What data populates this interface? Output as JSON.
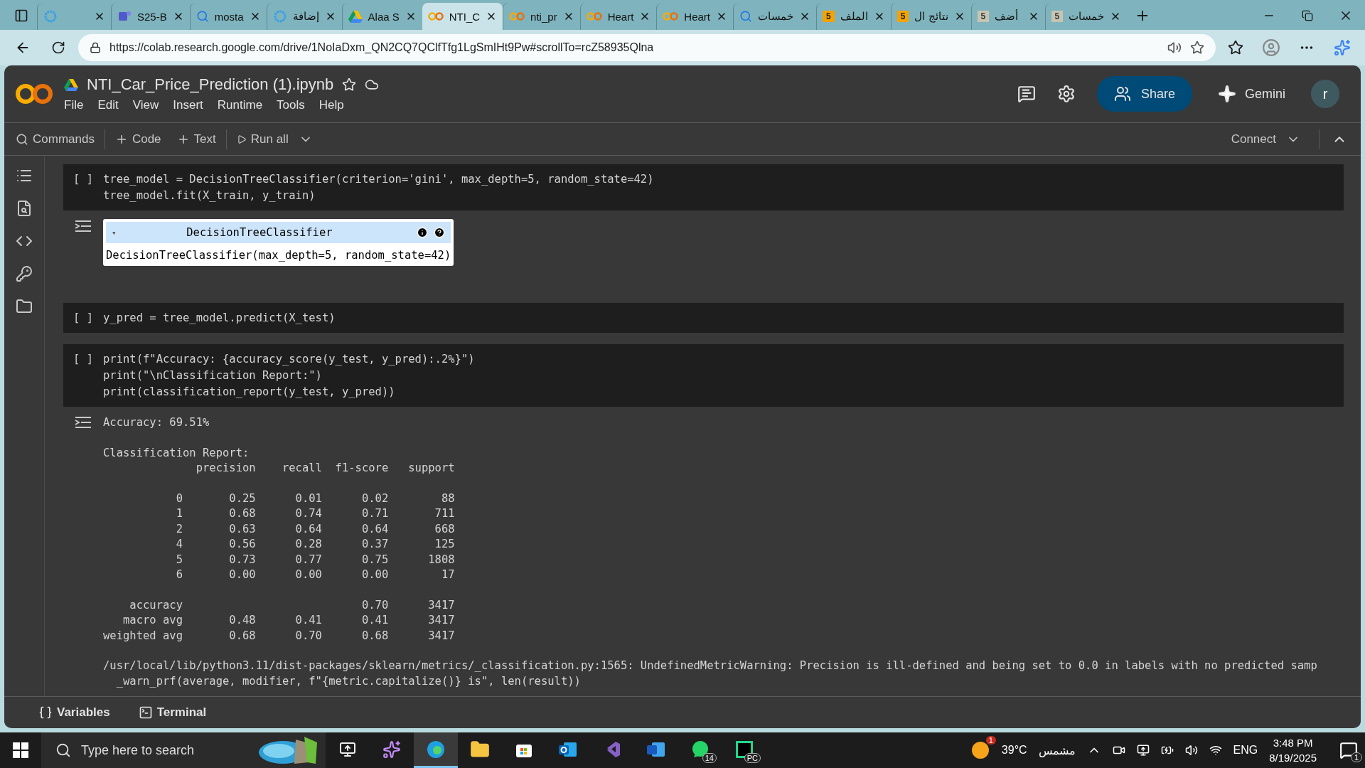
{
  "browser": {
    "tabs": [
      {
        "selected": false,
        "dimmed": false
      },
      {
        "label": "S25-B",
        "selected": false,
        "dimmed": false
      },
      {
        "label": "mosta",
        "selected": false,
        "dimmed": false
      },
      {
        "label": "إضافة",
        "selected": false,
        "dimmed": false
      },
      {
        "label": "Alaa S",
        "selected": false,
        "dimmed": false
      },
      {
        "label": "NTI_C",
        "selected": true,
        "dimmed": false
      },
      {
        "label": "nti_pr",
        "selected": false,
        "dimmed": false
      },
      {
        "label": "Heart",
        "selected": false,
        "dimmed": false
      },
      {
        "label": "Heart",
        "selected": false,
        "dimmed": false
      },
      {
        "label": "خمسات",
        "selected": false,
        "dimmed": false
      },
      {
        "badge": "5",
        "label": "الملف",
        "selected": false,
        "dimmed": false
      },
      {
        "badge": "5",
        "label": "نتائج ال",
        "selected": false,
        "dimmed": false
      },
      {
        "badge": "5",
        "label": "أضف",
        "selected": false,
        "dimmed": true
      },
      {
        "badge": "5",
        "label": "خمسات",
        "selected": false,
        "dimmed": true
      }
    ],
    "url": "https://colab.research.google.com/drive/1NoIaDxm_QN2CQ7QClfTfg1LgSmIHt9Pw#scrollTo=rcZ58935Qlna"
  },
  "notebook": {
    "title": "NTI_Car_Price_Prediction (1).ipynb",
    "menu": [
      "File",
      "Edit",
      "View",
      "Insert",
      "Runtime",
      "Tools",
      "Help"
    ],
    "share": "Share",
    "gemini": "Gemini",
    "avatar": "r",
    "toolbar": {
      "commands": "Commands",
      "code": "Code",
      "text": "Text",
      "run_all": "Run all",
      "connect": "Connect"
    },
    "cells": [
      {
        "prompt": "[ ]",
        "code": [
          "tree_model = DecisionTreeClassifier(criterion='gini', max_depth=5, random_state=42)",
          "tree_model.fit(X_train, y_train)"
        ],
        "output": {
          "kind": "estimator",
          "title": "DecisionTreeClassifier",
          "expand": "▾",
          "body": "DecisionTreeClassifier(max_depth=5, random_state=42)"
        }
      },
      {
        "prompt": "[ ]",
        "code": [
          "y_pred = tree_model.predict(X_test)"
        ]
      },
      {
        "prompt": "[ ]",
        "code": [
          "print(f\"Accuracy: {accuracy_score(y_test, y_pred):.2%}\")",
          "print(\"\\nClassification Report:\")",
          "print(classification_report(y_test, y_pred))"
        ],
        "output": {
          "kind": "text",
          "blocks": [
            [
              "Accuracy: 69.51%"
            ],
            [
              "Classification Report:",
              "              precision    recall  f1-score   support"
            ],
            [
              "           0       0.25      0.01      0.02        88",
              "           1       0.68      0.74      0.71       711",
              "           2       0.63      0.64      0.64       668",
              "           4       0.56      0.28      0.37       125",
              "           5       0.73      0.77      0.75      1808",
              "           6       0.00      0.00      0.00        17"
            ],
            [
              "    accuracy                           0.70      3417",
              "   macro avg       0.48      0.41      0.41      3417",
              "weighted avg       0.68      0.70      0.68      3417"
            ],
            [
              "/usr/local/lib/python3.11/dist-packages/sklearn/metrics/_classification.py:1565: UndefinedMetricWarning: Precision is ill-defined and being set to 0.0 in labels with no predicted samp",
              "  _warn_prf(average, modifier, f\"{metric.capitalize()} is\", len(result))"
            ]
          ]
        }
      }
    ],
    "bottom": [
      "Variables",
      "Terminal"
    ]
  },
  "taskbar": {
    "search_placeholder": "Type here to search",
    "apps": [
      {
        "selected": false
      },
      {
        "selected": false
      },
      {
        "selected": true
      },
      {
        "selected": false
      },
      {
        "selected": false
      },
      {
        "selected": false
      },
      {
        "selected": false
      },
      {
        "selected": false
      },
      {
        "badge": "14",
        "selected": false
      },
      {
        "badge": "PC",
        "selected": false
      }
    ],
    "weather_badge": "1",
    "temperature": "39°C",
    "weather": "مشمس",
    "language": "ENG",
    "time": "3:48 PM",
    "date": "8/19/2025",
    "notifications": "1"
  }
}
